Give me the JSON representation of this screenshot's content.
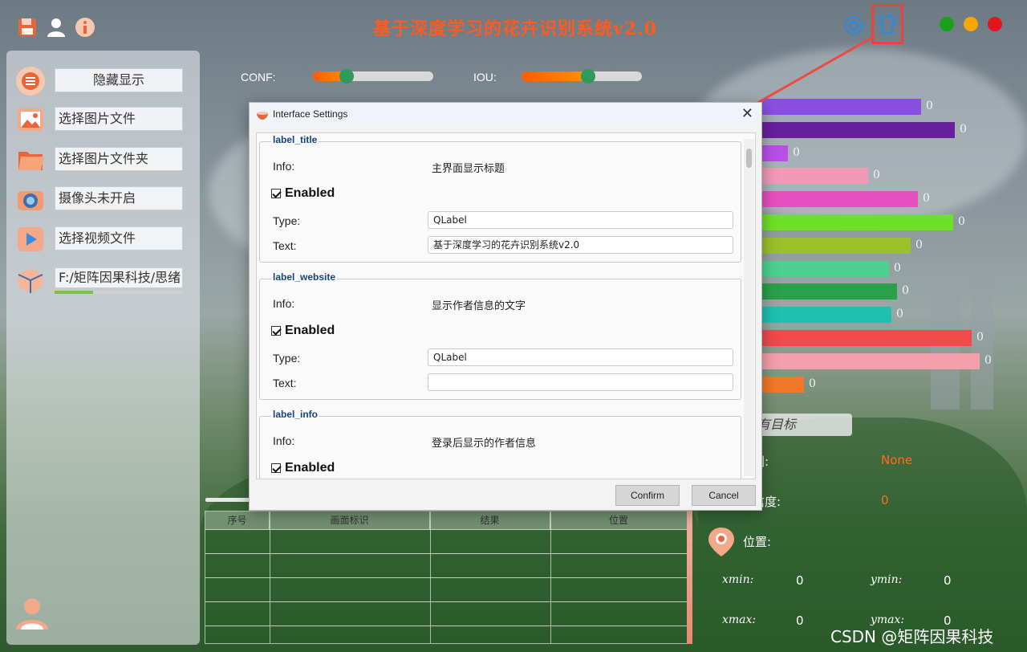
{
  "app": {
    "title": "基于深度学习的花卉识别系统v2.0"
  },
  "sidebar": {
    "items": [
      {
        "label": "隐藏显示",
        "icon": "menu-icon"
      },
      {
        "label": "选择图片文件",
        "icon": "image-icon"
      },
      {
        "label": "选择图片文件夹",
        "icon": "folder-icon"
      },
      {
        "label": "摄像头未开启",
        "icon": "camera-icon"
      },
      {
        "label": "选择视频文件",
        "icon": "video-icon"
      },
      {
        "label": "F:/矩阵因果科技/思绪",
        "icon": "model-box-icon"
      }
    ],
    "model_progress": 0.3
  },
  "sliders": {
    "conf": {
      "label": "CONF:",
      "value": 0.28
    },
    "iou": {
      "label": "IOU:",
      "value": 0.55
    }
  },
  "bars": [
    {
      "value": "0",
      "color": "#8a4fe0"
    },
    {
      "value": "0",
      "color": "#6a1f9a"
    },
    {
      "value": "0",
      "color": "#b94fe6"
    },
    {
      "value": "0",
      "color": "#f19ab8"
    },
    {
      "value": "0",
      "color": "#e64fc0"
    },
    {
      "value": "0",
      "color": "#6fe02a"
    },
    {
      "value": "0",
      "color": "#9ac02a"
    },
    {
      "value": "0",
      "color": "#4fd090"
    },
    {
      "value": "0",
      "color": "#2aa04a"
    },
    {
      "value": "0",
      "color": "#1fc0b0"
    },
    {
      "value": "0",
      "color": "#f04a4a"
    },
    {
      "value": "0",
      "color": "#f4a0a8"
    },
    {
      "value": "0",
      "color": "#f07a2a"
    }
  ],
  "right_panel": {
    "target_btn": "有目标",
    "class_label": "别:",
    "class_value": "None",
    "conf_label": "信度:",
    "conf_value": "0",
    "pos_label": "位置:",
    "xmin_label": "xmin:",
    "xmin_value": "0",
    "ymin_label": "ymin:",
    "ymin_value": "0",
    "xmax_label": "xmax:",
    "xmax_value": "0",
    "ymax_label": "ymax:",
    "ymax_value": "0"
  },
  "table": {
    "headers": [
      "序号",
      "画面标识",
      "结果",
      "位置"
    ]
  },
  "dialog": {
    "title": "Interface Settings",
    "groups": [
      {
        "name": "label_title",
        "info_label": "Info:",
        "info": "主界面显示标题",
        "enabled_label": "Enabled",
        "type_label": "Type:",
        "type": "QLabel",
        "text_label": "Text:",
        "text": "基于深度学习的花卉识别系统v2.0"
      },
      {
        "name": "label_website",
        "info_label": "Info:",
        "info": "显示作者信息的文字",
        "enabled_label": "Enabled",
        "type_label": "Type:",
        "type": "QLabel",
        "text_label": "Text:",
        "text": ""
      },
      {
        "name": "label_info",
        "info_label": "Info:",
        "info": "登录后显示的作者信息",
        "enabled_label": "Enabled"
      }
    ],
    "confirm": "Confirm",
    "cancel": "Cancel"
  },
  "watermark": "CSDN @矩阵因果科技",
  "colors": {
    "accent": "#ff5a1f",
    "highlight_box": "#e8433d",
    "window_green": "#1aa01a",
    "window_yellow": "#f5a800",
    "window_red": "#e0151e"
  }
}
